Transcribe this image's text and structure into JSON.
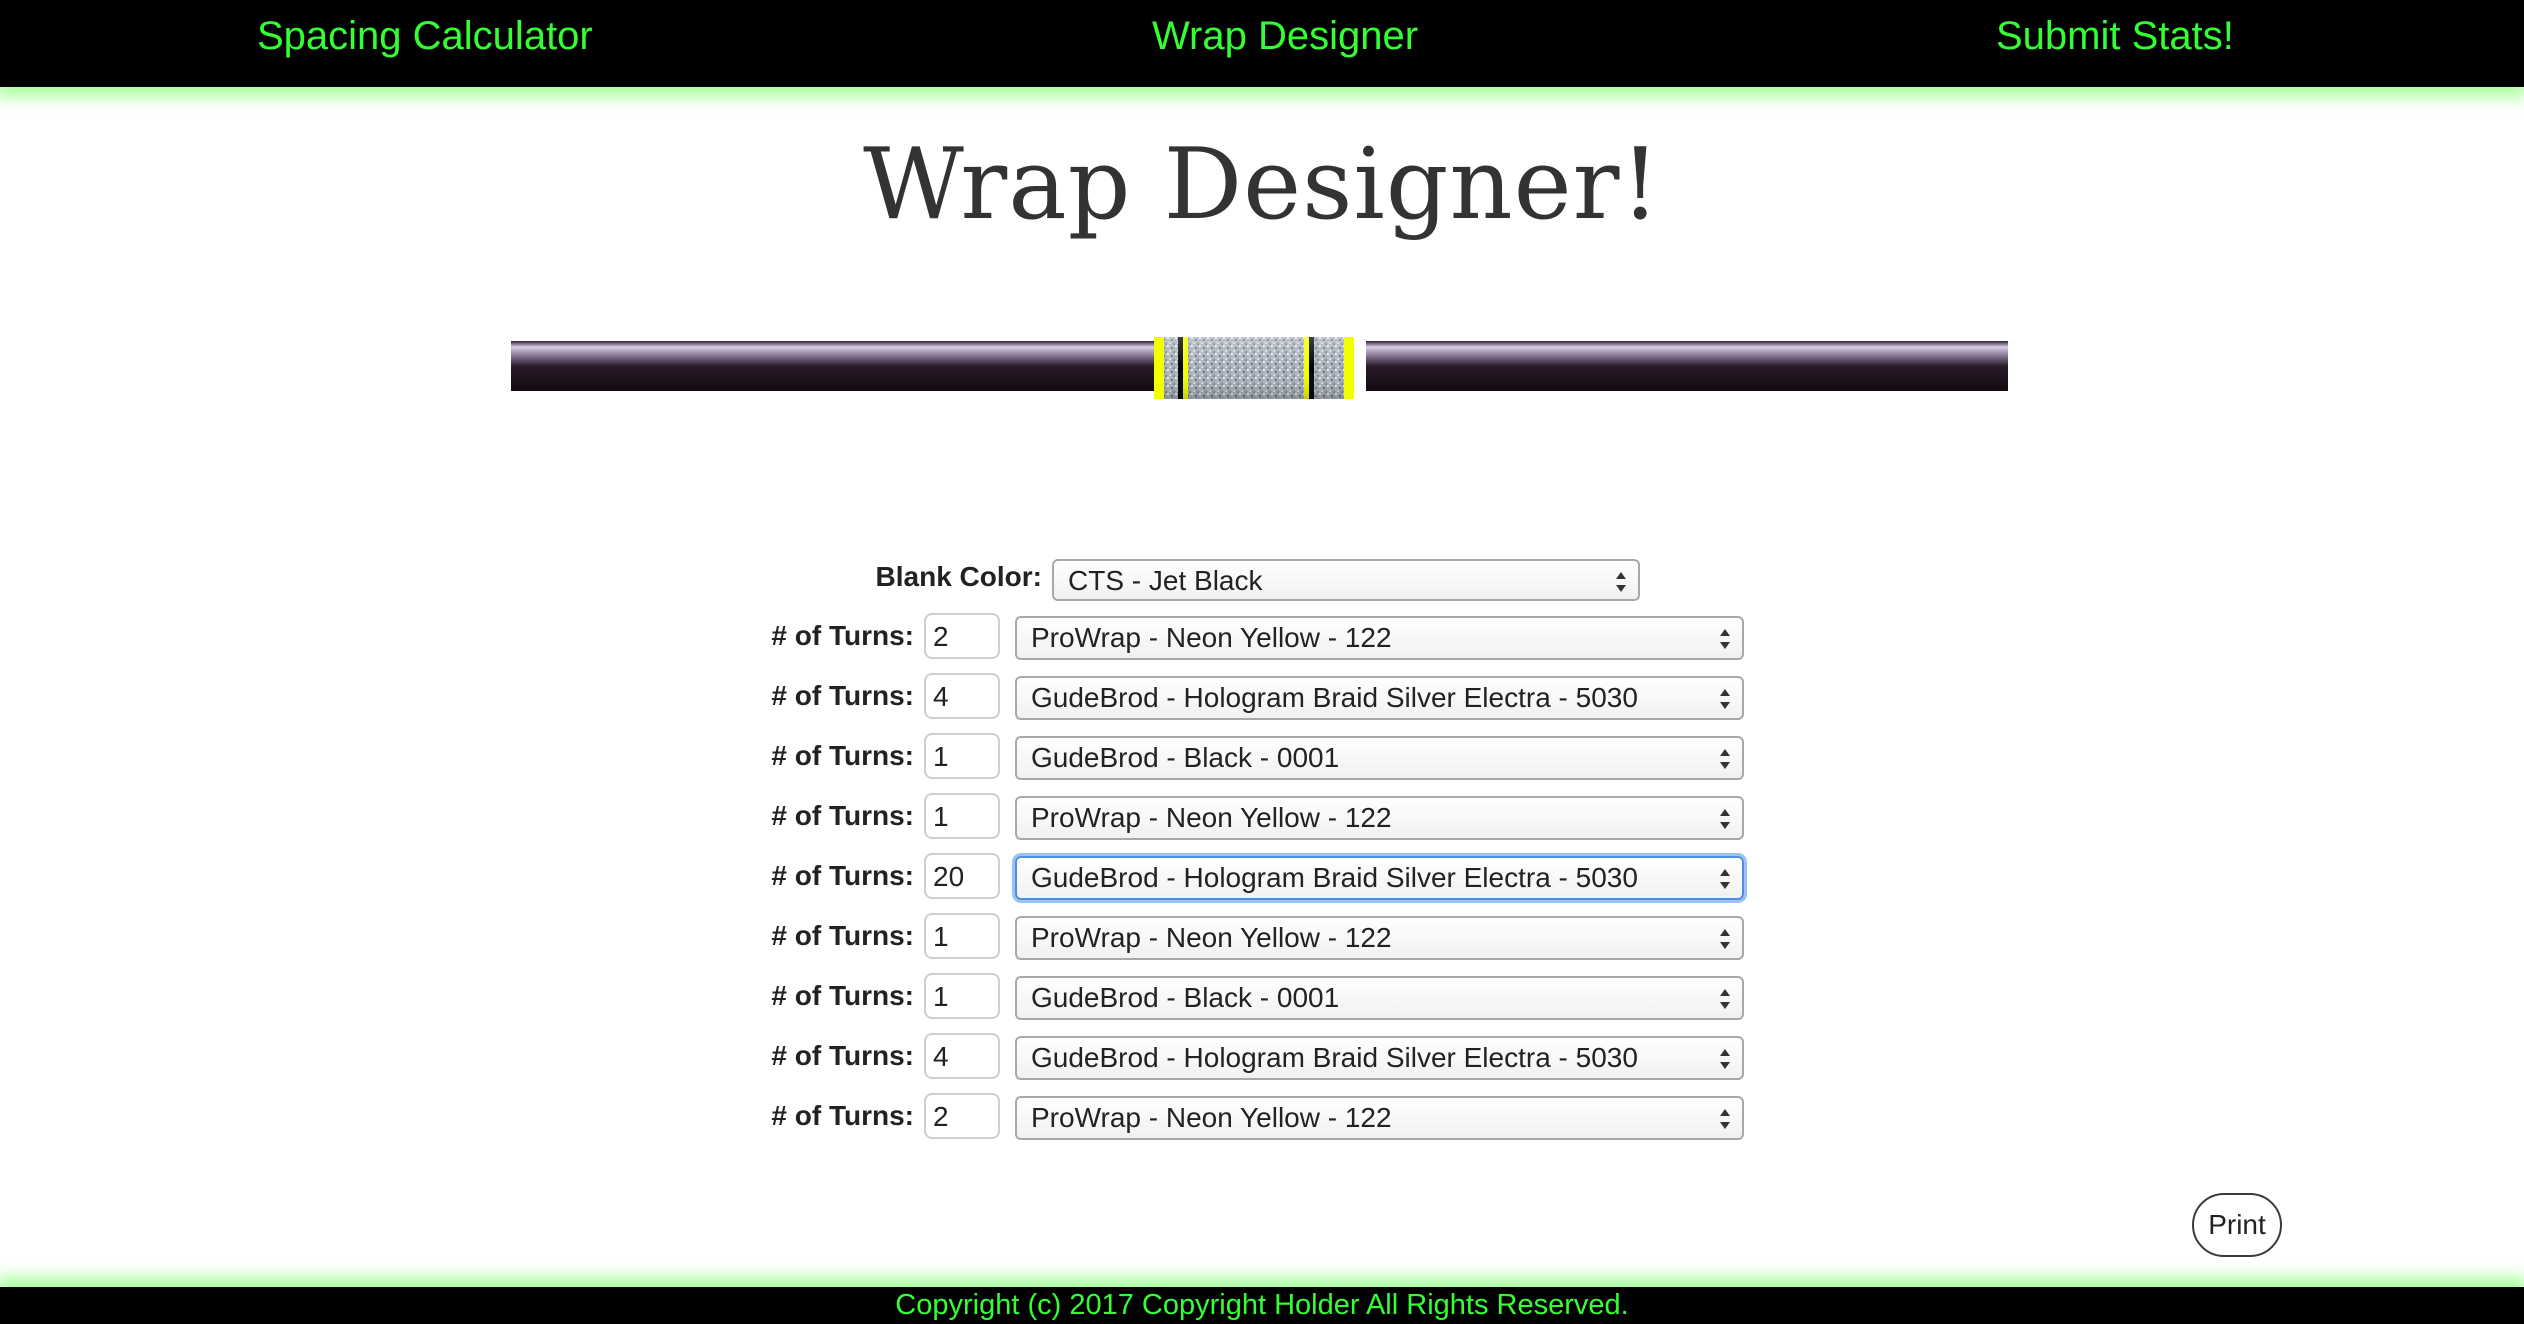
{
  "nav": {
    "items": [
      {
        "label": "Spacing Calculator"
      },
      {
        "label": "Wrap Designer"
      },
      {
        "label": "Submit Stats!"
      }
    ],
    "color": "#33ff33"
  },
  "page": {
    "title": "Wrap Designer!"
  },
  "form": {
    "blank_label": "Blank Color:",
    "blank_value": "CTS - Jet Black",
    "turn_label": "# of Turns:",
    "rows": [
      {
        "turns": "2",
        "thread": "ProWrap - Neon Yellow - 122"
      },
      {
        "turns": "4",
        "thread": "GudeBrod - Hologram Braid Silver Electra - 5030"
      },
      {
        "turns": "1",
        "thread": "GudeBrod - Black - 0001"
      },
      {
        "turns": "1",
        "thread": "ProWrap - Neon Yellow - 122"
      },
      {
        "turns": "20",
        "thread": "GudeBrod - Hologram Braid Silver Electra - 5030"
      },
      {
        "turns": "1",
        "thread": "ProWrap - Neon Yellow - 122"
      },
      {
        "turns": "1",
        "thread": "GudeBrod - Black - 0001"
      },
      {
        "turns": "4",
        "thread": "GudeBrod - Hologram Braid Silver Electra - 5030"
      },
      {
        "turns": "2",
        "thread": "ProWrap - Neon Yellow - 122"
      }
    ],
    "focused_row": 4
  },
  "print": {
    "label": "Print"
  },
  "footer": {
    "text": "Copyright (c) 2017 Copyright Holder All Rights Reserved."
  },
  "colors": {
    "neon_yellow": "#f2ff00",
    "black": "#000000",
    "hologram_silver": "#a8b0b8",
    "accent_green": "#33ff33",
    "focus_blue": "#4a90e2"
  }
}
